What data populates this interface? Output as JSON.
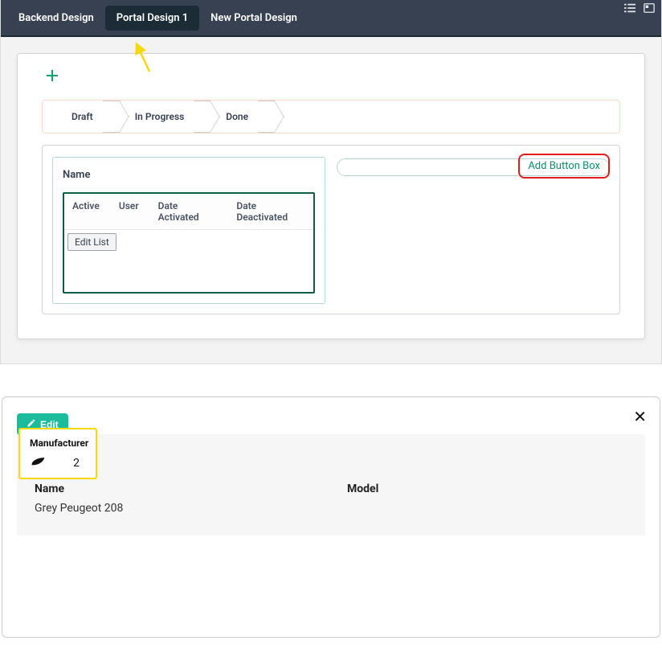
{
  "navbar": {
    "tabs": [
      {
        "label": "Backend Design"
      },
      {
        "label": "Portal Design 1"
      },
      {
        "label": "New Portal Design"
      }
    ]
  },
  "designer": {
    "statusbar": {
      "steps": [
        "Draft",
        "In Progress",
        "Done"
      ]
    },
    "field_name_label": "Name",
    "list_columns": [
      "Active",
      "User",
      "Date Activated",
      "Date Deactivated"
    ],
    "edit_list_label": "Edit List",
    "add_button_box_label": "Add Button Box"
  },
  "record_view": {
    "edit_label": "Edit",
    "stat": {
      "title": "Manufacturer",
      "value": "2"
    },
    "fields": {
      "name_label": "Name",
      "name_value": "Grey Peugeot 208",
      "model_label": "Model",
      "model_value": ""
    }
  }
}
